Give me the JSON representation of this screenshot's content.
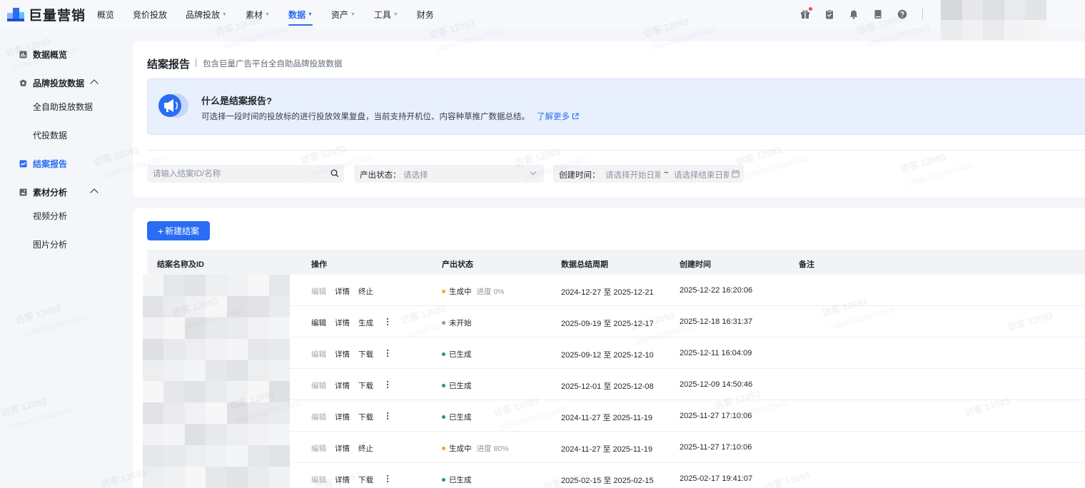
{
  "brand": {
    "name": "巨量营销"
  },
  "nav": [
    {
      "label": "概览",
      "caret": false,
      "active": false
    },
    {
      "label": "竞价投放",
      "caret": false,
      "active": false
    },
    {
      "label": "品牌投放",
      "caret": true,
      "active": false
    },
    {
      "label": "素材",
      "caret": true,
      "active": false
    },
    {
      "label": "数据",
      "caret": true,
      "active": true
    },
    {
      "label": "资产",
      "caret": true,
      "active": false
    },
    {
      "label": "工具",
      "caret": true,
      "active": false
    },
    {
      "label": "财务",
      "caret": false,
      "active": false
    }
  ],
  "nav_icons": [
    "gift-icon",
    "clipboard-check-icon",
    "bell-icon",
    "book-icon",
    "help-icon"
  ],
  "sidebar": [
    {
      "label": "数据概览",
      "icon": "chart-icon",
      "group": true,
      "active": false
    },
    {
      "label": "品牌投放数据",
      "icon": "shield-icon",
      "group": true,
      "active": false,
      "expanded": true
    },
    {
      "label": "全自助投放数据",
      "icon": "",
      "group": false,
      "active": false
    },
    {
      "label": "代投数据",
      "icon": "",
      "group": false,
      "active": false
    },
    {
      "label": "结案报告",
      "icon": "trend-icon",
      "group": true,
      "active": true
    },
    {
      "label": "素材分析",
      "icon": "image-box-icon",
      "group": true,
      "active": false,
      "expanded": true
    },
    {
      "label": "视频分析",
      "icon": "",
      "group": false,
      "active": false
    },
    {
      "label": "图片分析",
      "icon": "",
      "group": false,
      "active": false
    }
  ],
  "page": {
    "title": "结案报告",
    "subtitle": "包含巨量广告平台全自助品牌投放数据"
  },
  "info": {
    "title": "什么是结案报告?",
    "desc": "可选择一段时间的投放标的进行投放效果复盘，当前支持开机位、内容种草推广数据总结。",
    "link": "了解更多"
  },
  "filters": {
    "search_placeholder": "请输入结案ID/名称",
    "status_label": "产出状态：",
    "status_placeholder": "请选择",
    "created_label": "创建时间：",
    "start_placeholder": "请选择开始日期",
    "tilde": "~",
    "end_placeholder": "请选择结束日期"
  },
  "actions": {
    "new_label": "新建结案"
  },
  "table": {
    "columns": [
      "结案名称及ID",
      "操作",
      "产出状态",
      "数据总结周期",
      "创建时间",
      "备注"
    ],
    "rows": [
      {
        "ops": [
          {
            "label": "编辑",
            "disabled": true
          },
          {
            "label": "详情",
            "disabled": false
          },
          {
            "label": "终止",
            "disabled": false
          }
        ],
        "more": false,
        "status": "生成中",
        "status_color": "#f5a623",
        "progress": "进度 0%",
        "period": "2024-12-27 至 2025-12-21",
        "created": "2025-12-22 16:20:06"
      },
      {
        "ops": [
          {
            "label": "编辑",
            "disabled": false
          },
          {
            "label": "详情",
            "disabled": false
          },
          {
            "label": "生成",
            "disabled": false
          }
        ],
        "more": true,
        "status": "未开始",
        "status_color": "#8f959e",
        "progress": "",
        "period": "2025-09-19 至 2025-12-17",
        "created": "2025-12-18 16:31:37"
      },
      {
        "ops": [
          {
            "label": "编辑",
            "disabled": true
          },
          {
            "label": "详情",
            "disabled": false
          },
          {
            "label": "下载",
            "disabled": false
          }
        ],
        "more": true,
        "status": "已生成",
        "status_color": "#1aa14f",
        "progress": "",
        "period": "2025-09-12 至 2025-12-10",
        "created": "2025-12-11 16:04:09"
      },
      {
        "ops": [
          {
            "label": "编辑",
            "disabled": true
          },
          {
            "label": "详情",
            "disabled": false
          },
          {
            "label": "下载",
            "disabled": false
          }
        ],
        "more": true,
        "status": "已生成",
        "status_color": "#1aa14f",
        "progress": "",
        "period": "2025-12-01 至 2025-12-08",
        "created": "2025-12-09 14:50:46"
      },
      {
        "ops": [
          {
            "label": "编辑",
            "disabled": true
          },
          {
            "label": "详情",
            "disabled": false
          },
          {
            "label": "下载",
            "disabled": false
          }
        ],
        "more": true,
        "status": "已生成",
        "status_color": "#1aa14f",
        "progress": "",
        "period": "2024-11-27 至 2025-11-19",
        "created": "2025-11-27 17:10:06"
      },
      {
        "ops": [
          {
            "label": "编辑",
            "disabled": true
          },
          {
            "label": "详情",
            "disabled": false
          },
          {
            "label": "终止",
            "disabled": false
          }
        ],
        "more": false,
        "status": "生成中",
        "status_color": "#f5a623",
        "progress": "进度 80%",
        "period": "2024-11-27 至 2025-11-19",
        "created": "2025-11-27 17:10:06"
      },
      {
        "ops": [
          {
            "label": "编辑",
            "disabled": true
          },
          {
            "label": "详情",
            "disabled": false
          },
          {
            "label": "下载",
            "disabled": false
          }
        ],
        "more": true,
        "status": "已生成",
        "status_color": "#1aa14f",
        "progress": "",
        "period": "2025-02-15 至 2025-02-15",
        "created": "2025-02-17 19:41:07"
      }
    ]
  },
  "watermark": {
    "primary": "访客 12093",
    "secondary": "16884762209223803"
  },
  "colors": {
    "accent": "#2a6df4",
    "text": "#1f2329",
    "muted": "#8f959e",
    "bg": "#f4f6fa"
  }
}
